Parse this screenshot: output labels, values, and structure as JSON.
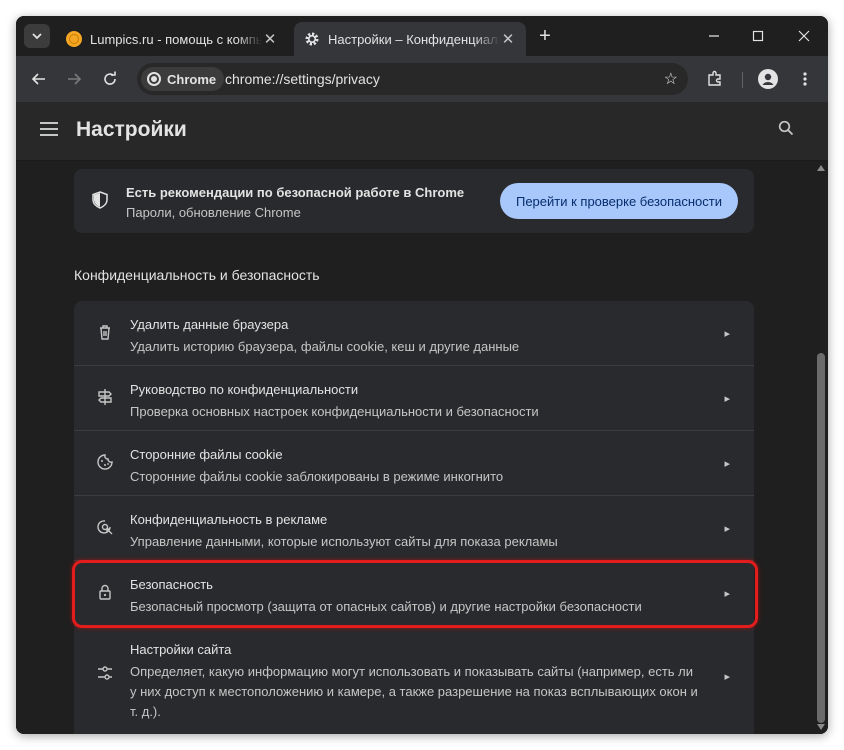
{
  "tabs": [
    {
      "title": "Lumpics.ru - помощь с компьютером",
      "icon": "lumpics-favicon-icon",
      "active": false
    },
    {
      "title": "Настройки – Конфиденциальность и безопасность",
      "icon": "gear-icon",
      "active": true
    }
  ],
  "toolbar": {
    "chip_label": "Chrome",
    "url": "chrome://settings/privacy"
  },
  "header": {
    "title": "Настройки"
  },
  "safety_card": {
    "title": "Есть рекомендации по безопасной работе в Chrome",
    "subtitle": "Пароли, обновление Chrome",
    "button": "Перейти к проверке безопасности"
  },
  "section_title": "Конфиденциальность и безопасность",
  "items": [
    {
      "label": "Удалить данные браузера",
      "sub": "Удалить историю браузера, файлы cookie, кеш и другие данные",
      "icon": "trash-icon"
    },
    {
      "label": "Руководство по конфиденциальности",
      "sub": "Проверка основных настроек конфиденциальности и безопасности",
      "icon": "signpost-icon"
    },
    {
      "label": "Сторонние файлы cookie",
      "sub": "Сторонние файлы cookie заблокированы в режиме инкогнито",
      "icon": "cookie-icon"
    },
    {
      "label": "Конфиденциальность в рекламе",
      "sub": "Управление данными, которые используют сайты для показа рекламы",
      "icon": "ad-privacy-icon"
    },
    {
      "label": "Безопасность",
      "sub": "Безопасный просмотр (защита от опасных сайтов) и другие настройки безопасности",
      "icon": "lock-icon"
    },
    {
      "label": "Настройки сайта",
      "sub": "Определяет, какую информацию могут использовать и показывать сайты (например, есть ли у них доступ к местоположению и камере, а также разрешение на показ всплывающих окон и т. д.).",
      "icon": "sliders-icon"
    }
  ],
  "colors": {
    "accent_button": "#a8c7fa",
    "highlight": "#e31d1d",
    "background": "#1f1f1f"
  }
}
